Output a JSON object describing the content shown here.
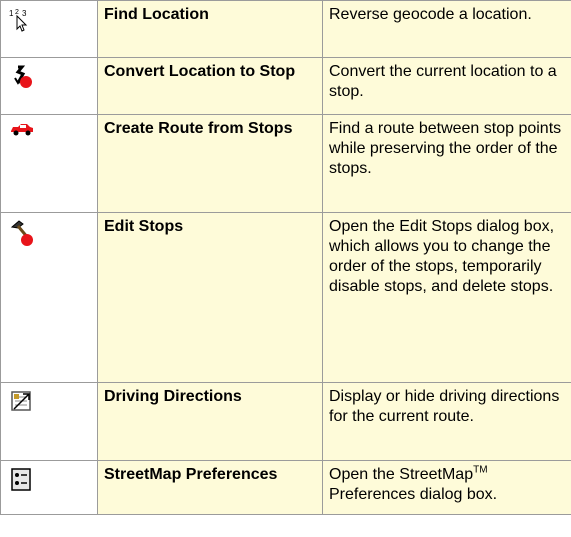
{
  "rows": [
    {
      "icon": "find-location-icon",
      "name": "Find Location",
      "desc": "Reverse geocode a location."
    },
    {
      "icon": "convert-location-icon",
      "name": "Convert Location  to Stop",
      "desc": "Convert the current location to a stop."
    },
    {
      "icon": "create-route-car-icon",
      "name": "Create Route from Stops",
      "desc": "Find a route between stop points while preserving the order of the stops."
    },
    {
      "icon": "edit-stops-hammer-icon",
      "name": "Edit Stops",
      "desc": "Open the Edit Stops dialog box, which allows you to change the order of the stops, temporarily disable stops, and delete stops."
    },
    {
      "icon": "driving-directions-icon",
      "name": "Driving Directions",
      "desc": "Display or hide driving directions for the current route."
    },
    {
      "icon": "streetmap-preferences-icon",
      "name": "StreetMap Preferences",
      "desc_pre": "Open the StreetMap",
      "desc_tm": "TM",
      "desc_post": " Preferences dialog box."
    }
  ],
  "colors": {
    "cell_bg": "#fefbd9",
    "border": "#9b9b9b",
    "stop_red": "#e8141a"
  }
}
